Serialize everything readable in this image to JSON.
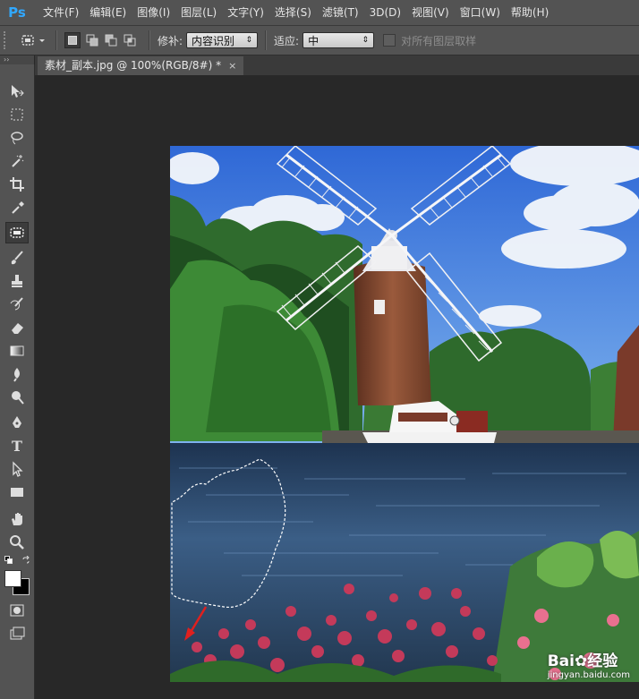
{
  "app": {
    "logo": "Ps"
  },
  "menu": [
    "文件(F)",
    "编辑(E)",
    "图像(I)",
    "图层(L)",
    "文字(Y)",
    "选择(S)",
    "滤镜(T)",
    "3D(D)",
    "视图(V)",
    "窗口(W)",
    "帮助(H)"
  ],
  "options": {
    "patch_label": "修补:",
    "patch_value": "内容识别",
    "adapt_label": "适应:",
    "adapt_value": "中",
    "sample_all_label": "对所有图层取样"
  },
  "document": {
    "tab_title": "素材_副本.jpg @ 100%(RGB/8#) *",
    "close": "×"
  },
  "toolbar": {
    "grip": "››",
    "tools": [
      "move-tool",
      "marquee-tool",
      "lasso-tool",
      "magic-wand-tool",
      "crop-tool",
      "eyedropper-tool",
      "patch-tool",
      "brush-tool",
      "clone-stamp-tool",
      "history-brush-tool",
      "eraser-tool",
      "gradient-tool",
      "blur-tool",
      "dodge-tool",
      "pen-tool",
      "type-tool",
      "path-selection-tool",
      "rectangle-tool",
      "hand-tool",
      "zoom-tool"
    ],
    "type_tool_glyph": "T",
    "foreground_color": "#ffffff",
    "background_color": "#000000"
  },
  "watermark": {
    "brand": "Bai",
    "brand_suffix": "经验",
    "url": "jingyan.baidu.com"
  },
  "colors": {
    "ui_panel": "#535353",
    "ui_dark": "#282828",
    "accent_ps": "#31a8ff",
    "arrow": "#e0201e"
  }
}
